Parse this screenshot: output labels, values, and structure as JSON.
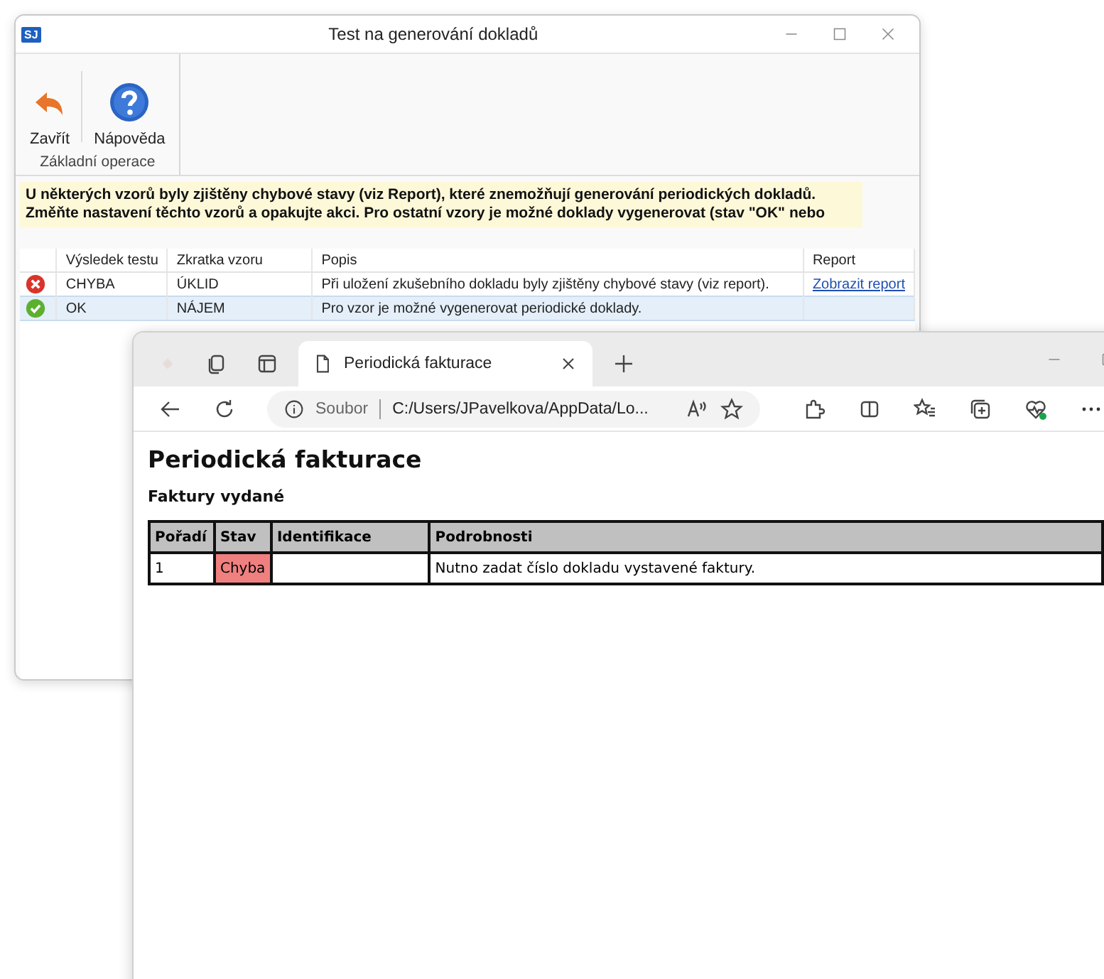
{
  "dialog": {
    "logo": "SJ",
    "title": "Test na generování dokladů",
    "ribbon": {
      "buttons": [
        {
          "kind": "close",
          "label": "Zavřít"
        },
        {
          "kind": "help",
          "label": "Nápověda"
        }
      ],
      "group": "Základní operace"
    },
    "message": [
      "U některých vzorů byly zjištěny chybové stavy (viz Report), které znemožňují generování periodických dokladů.",
      "Změňte nastavení těchto vzorů a opakujte akci. Pro ostatní vzory je možné doklady vygenerovat (stav \"OK\" nebo"
    ],
    "table": {
      "columns": [
        "Výsledek testu",
        "Zkratka vzoru",
        "Popis",
        "Report"
      ],
      "rows": [
        {
          "kind": "error",
          "result": "CHYBA",
          "code": "ÚKLID",
          "description": "Při uložení zkušebního dokladu byly zjištěny chybové stavy (viz report).",
          "report": "Zobrazit report",
          "selected": false
        },
        {
          "kind": "ok",
          "result": "OK",
          "code": "NÁJEM",
          "description": "Pro vzor je možné vygenerovat periodické doklady.",
          "selected": true
        }
      ]
    }
  },
  "browser": {
    "tab": {
      "title": "Periodická fakturace",
      "selected": true
    },
    "address": {
      "scheme": "Soubor",
      "url": "C:/Users/JPavelkova/AppData/Lo..."
    },
    "page": {
      "heading": "Periodická fakturace",
      "subheading": "Faktury vydané",
      "table": {
        "columns": [
          "Pořadí",
          "Stav",
          "Identifikace",
          "Podrobnosti"
        ],
        "rows": [
          {
            "order": "1",
            "status": "Chyba",
            "color": "#f08080",
            "details": "Nutno zadat číslo dokladu vystavené faktury."
          }
        ]
      }
    }
  }
}
